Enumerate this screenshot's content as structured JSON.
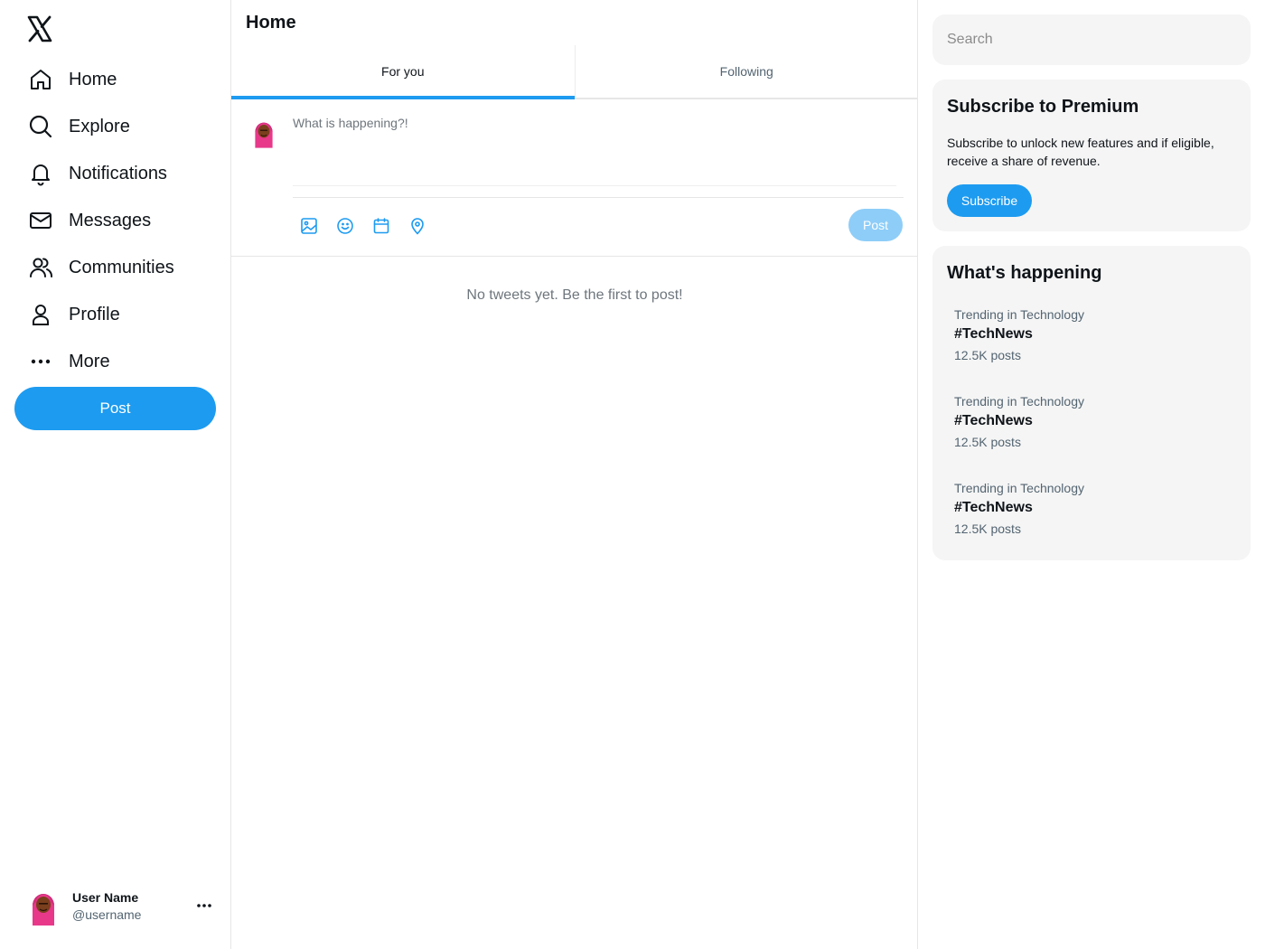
{
  "sidebar": {
    "logo": "x-logo-icon",
    "items": [
      {
        "label": "Home",
        "icon": "home-icon"
      },
      {
        "label": "Explore",
        "icon": "search-icon"
      },
      {
        "label": "Notifications",
        "icon": "bell-icon"
      },
      {
        "label": "Messages",
        "icon": "mail-icon"
      },
      {
        "label": "Communities",
        "icon": "people-icon"
      },
      {
        "label": "Profile",
        "icon": "person-icon"
      },
      {
        "label": "More",
        "icon": "more-dots-icon"
      }
    ],
    "post_label": "Post",
    "user": {
      "name": "User Name",
      "handle": "@username"
    }
  },
  "main": {
    "title": "Home",
    "tabs": [
      {
        "label": "For you",
        "active": true
      },
      {
        "label": "Following",
        "active": false
      }
    ],
    "composer": {
      "placeholder": "What is happening?!",
      "tools": [
        "image-icon",
        "emoji-icon",
        "schedule-icon",
        "location-icon"
      ],
      "post_label": "Post"
    },
    "empty_message": "No tweets yet. Be the first to post!"
  },
  "right": {
    "search_placeholder": "Search",
    "premium": {
      "title": "Subscribe to Premium",
      "description": "Subscribe to unlock new features and if eligible, receive a share of revenue.",
      "button_label": "Subscribe"
    },
    "happening": {
      "title": "What's happening",
      "trends": [
        {
          "context": "Trending in Technology",
          "tag": "#TechNews",
          "count": "12.5K posts"
        },
        {
          "context": "Trending in Technology",
          "tag": "#TechNews",
          "count": "12.5K posts"
        },
        {
          "context": "Trending in Technology",
          "tag": "#TechNews",
          "count": "12.5K posts"
        }
      ]
    }
  },
  "colors": {
    "accent": "#1d9bf0",
    "accent_disabled": "#8ecdf8",
    "panel": "#f5f5f5",
    "text": "#0f1419",
    "muted": "#536471"
  }
}
